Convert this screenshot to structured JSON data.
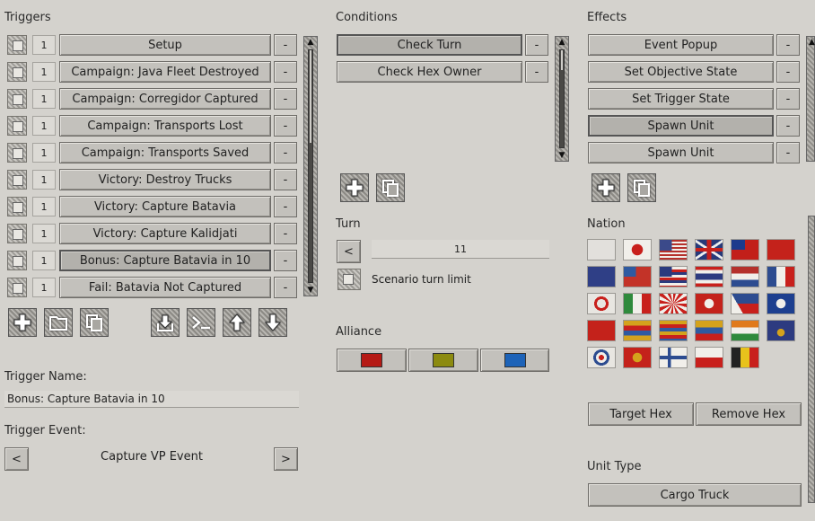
{
  "triggers": {
    "title": "Triggers",
    "items": [
      {
        "num": "1",
        "label": "Setup"
      },
      {
        "num": "1",
        "label": "Campaign: Java Fleet Destroyed"
      },
      {
        "num": "1",
        "label": "Campaign: Corregidor Captured"
      },
      {
        "num": "1",
        "label": "Campaign: Transports Lost"
      },
      {
        "num": "1",
        "label": "Campaign: Transports Saved"
      },
      {
        "num": "1",
        "label": "Victory: Destroy Trucks"
      },
      {
        "num": "1",
        "label": "Victory: Capture Batavia"
      },
      {
        "num": "1",
        "label": "Victory: Capture Kalidjati"
      },
      {
        "num": "1",
        "label": "Bonus: Capture Batavia in 10"
      },
      {
        "num": "1",
        "label": "Fail: Batavia Not Captured"
      }
    ],
    "remove_label": "-",
    "selected_index": 8
  },
  "trigger_name": {
    "label": "Trigger Name:",
    "value": "Bonus: Capture Batavia in 10"
  },
  "trigger_event": {
    "label": "Trigger Event:",
    "value": "Capture VP Event",
    "prev": "<",
    "next": ">"
  },
  "conditions": {
    "title": "Conditions",
    "items": [
      {
        "label": "Check Turn"
      },
      {
        "label": "Check Hex Owner"
      }
    ],
    "remove_label": "-"
  },
  "turn": {
    "label": "Turn",
    "prev": "<",
    "value": "11",
    "limit_label": "Scenario turn limit"
  },
  "alliance": {
    "label": "Alliance",
    "colors": [
      "#b51a15",
      "#8c8b10",
      "#1d63b8"
    ]
  },
  "effects": {
    "title": "Effects",
    "items": [
      {
        "label": "Event Popup"
      },
      {
        "label": "Set Objective State"
      },
      {
        "label": "Set Trigger State"
      },
      {
        "label": "Spawn Unit"
      },
      {
        "label": "Spawn Unit"
      }
    ],
    "remove_label": "-"
  },
  "nation": {
    "label": "Nation",
    "flags": [
      "blank",
      "japan",
      "usa",
      "uk",
      "taiwan",
      "ussr",
      "australia",
      "burma",
      "hawaii",
      "thailand",
      "netherlands",
      "france",
      "siam-target",
      "italy",
      "rising-sun",
      "hong-kong",
      "philippines",
      "blue-star",
      "china",
      "stripes-1",
      "stripes-2",
      "stripes-3",
      "india",
      "nepal",
      "roundel",
      "eagle",
      "finland",
      "poland",
      "belgium"
    ]
  },
  "hex": {
    "target": "Target Hex",
    "remove": "Remove Hex"
  },
  "unit_type": {
    "label": "Unit Type",
    "value": "Cargo Truck"
  },
  "icons": [
    "plus-icon",
    "folder-icon",
    "copy-icon",
    "import-icon",
    "console-icon",
    "arrow-up-icon",
    "arrow-down-icon"
  ]
}
